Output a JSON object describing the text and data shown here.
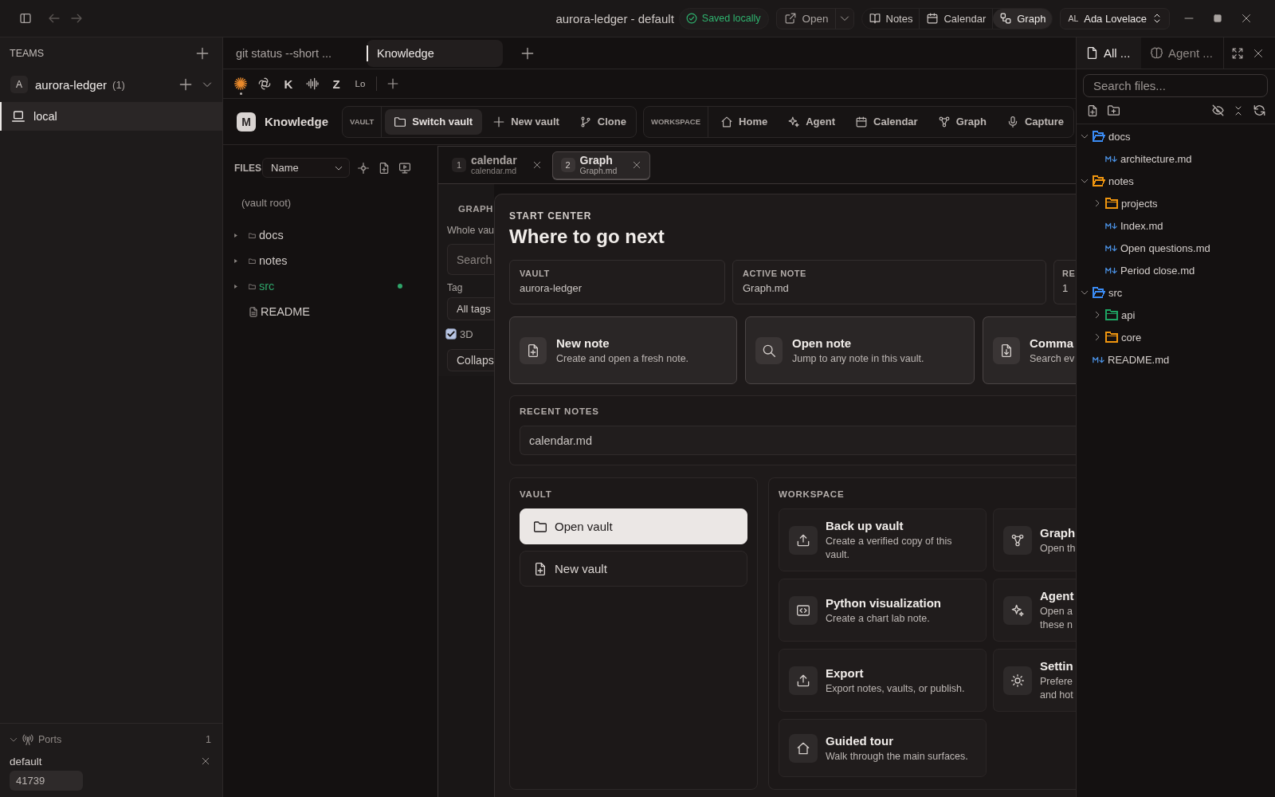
{
  "title_bar": {
    "nav": {
      "back": {
        "disabled": true
      },
      "forward": {
        "disabled": true
      }
    },
    "title": "aurora-ledger - default",
    "save_status": "Saved locally",
    "open_button": "Open",
    "views": [
      {
        "label": "Notes",
        "selected": false
      },
      {
        "label": "Calendar",
        "selected": false
      },
      {
        "label": "Graph",
        "selected": true
      }
    ],
    "user": {
      "initials": "AL",
      "name": "Ada Lovelace"
    }
  },
  "sidebar": {
    "heading": "TEAMS",
    "team": {
      "initial": "A",
      "name": "aurora-ledger",
      "count": "(1)"
    },
    "items": [
      {
        "label": "local",
        "selected": true
      }
    ],
    "ports": {
      "title": "Ports",
      "count": "1",
      "expanded": true,
      "entries": [
        {
          "name": "default",
          "port": "41739"
        }
      ]
    }
  },
  "session_tabs": [
    {
      "label": "git status --short ...",
      "selected": false
    },
    {
      "label": "Knowledge",
      "selected": true
    }
  ],
  "app_launcher": [
    {
      "kind": "icon",
      "selected": true
    },
    {
      "kind": "icon",
      "selected": false
    },
    {
      "kind": "letter",
      "label": "K",
      "selected": false
    },
    {
      "kind": "icon",
      "selected": false
    },
    {
      "kind": "letter",
      "label": "Z",
      "selected": false
    },
    {
      "kind": "text",
      "label": "Lo",
      "selected": false
    }
  ],
  "knowledge_header": {
    "logo": "M",
    "title": "Knowledge",
    "groups": [
      {
        "label": "VAULT",
        "actions": [
          {
            "label": "Switch vault",
            "selected": true
          },
          {
            "label": "New vault",
            "selected": false
          },
          {
            "label": "Clone",
            "selected": false
          }
        ]
      },
      {
        "label": "WORKSPACE",
        "actions": [
          {
            "label": "Home",
            "selected": false
          },
          {
            "label": "Agent",
            "selected": false
          },
          {
            "label": "Calendar",
            "selected": false
          },
          {
            "label": "Graph",
            "selected": false
          },
          {
            "label": "Capture",
            "selected": false
          }
        ]
      }
    ]
  },
  "files_panel": {
    "heading": "FILES",
    "sort": "Name",
    "root": "(vault root)",
    "items": [
      {
        "kind": "folder",
        "name": "docs",
        "changed": false
      },
      {
        "kind": "folder",
        "name": "notes",
        "changed": false
      },
      {
        "kind": "folder",
        "name": "src",
        "changed": true
      },
      {
        "kind": "file",
        "name": "README",
        "changed": false
      }
    ]
  },
  "note_tabs": [
    {
      "number": "1",
      "title": "calendar",
      "file": "calendar.md",
      "selected": false
    },
    {
      "number": "2",
      "title": "Graph",
      "file": "Graph.md",
      "selected": true
    }
  ],
  "graph_panel": {
    "heading": "GRAPH",
    "scope": "Whole vau",
    "search_placeholder": "Search",
    "tag_label": "Tag",
    "tag_value": "All tags",
    "options": [
      {
        "label": "3D",
        "checked": true
      }
    ],
    "collapse_button": "Collaps"
  },
  "start_center": {
    "eyebrow": "START CENTER",
    "title": "Where to go next",
    "info_cards": [
      {
        "label": "VAULT",
        "value": "aurora-ledger"
      },
      {
        "label": "ACTIVE NOTE",
        "value": "Graph.md"
      },
      {
        "label": "RE",
        "value": "1"
      }
    ],
    "quick_actions": [
      {
        "title": "New note",
        "description": "Create and open a fresh note."
      },
      {
        "title": "Open note",
        "description": "Jump to any note in this vault."
      },
      {
        "title": "Comma",
        "description": "Search ev"
      }
    ],
    "recent_notes": {
      "heading": "RECENT NOTES",
      "items": [
        "calendar.md"
      ]
    },
    "vault": {
      "heading": "VAULT",
      "actions": [
        {
          "label": "Open vault",
          "selected": true
        },
        {
          "label": "New vault",
          "selected": false
        }
      ]
    },
    "workspace": {
      "heading": "WORKSPACE",
      "cards": [
        {
          "title": "Back up vault",
          "description": "Create a verified copy of this vault."
        },
        {
          "title": "Graph",
          "description": "Open th"
        },
        {
          "title": "Python visualization",
          "description": "Create a chart lab note."
        },
        {
          "title": "Agent",
          "description": "Open a these n"
        },
        {
          "title": "Export",
          "description": "Export notes, vaults, or publish."
        },
        {
          "title": "Settin",
          "description": "Prefere and hot"
        },
        {
          "title": "Guided tour",
          "description": "Walk through the main surfaces."
        }
      ]
    }
  },
  "explorer": {
    "tabs": [
      {
        "label": "All ...",
        "selected": true
      },
      {
        "label": "Agent ...",
        "selected": false
      }
    ],
    "search_placeholder": "Search files...",
    "tree": [
      {
        "kind": "folder",
        "name": "docs",
        "color": "#3b8cf5",
        "expanded": true,
        "children": [
          {
            "kind": "markdown",
            "name": "architecture.md"
          }
        ]
      },
      {
        "kind": "folder",
        "name": "notes",
        "color": "#f0960f",
        "expanded": true,
        "children": [
          {
            "kind": "folder",
            "name": "projects",
            "color": "#f0960f",
            "expanded": false
          },
          {
            "kind": "markdown",
            "name": "Index.md"
          },
          {
            "kind": "markdown",
            "name": "Open questions.md"
          },
          {
            "kind": "markdown",
            "name": "Period close.md"
          }
        ]
      },
      {
        "kind": "folder",
        "name": "src",
        "color": "#3b8cf5",
        "expanded": true,
        "children": [
          {
            "kind": "folder",
            "name": "api",
            "color": "#1ea463",
            "expanded": false
          },
          {
            "kind": "folder",
            "name": "core",
            "color": "#f0960f",
            "expanded": false
          }
        ]
      },
      {
        "kind": "markdown",
        "name": "README.md"
      }
    ]
  }
}
